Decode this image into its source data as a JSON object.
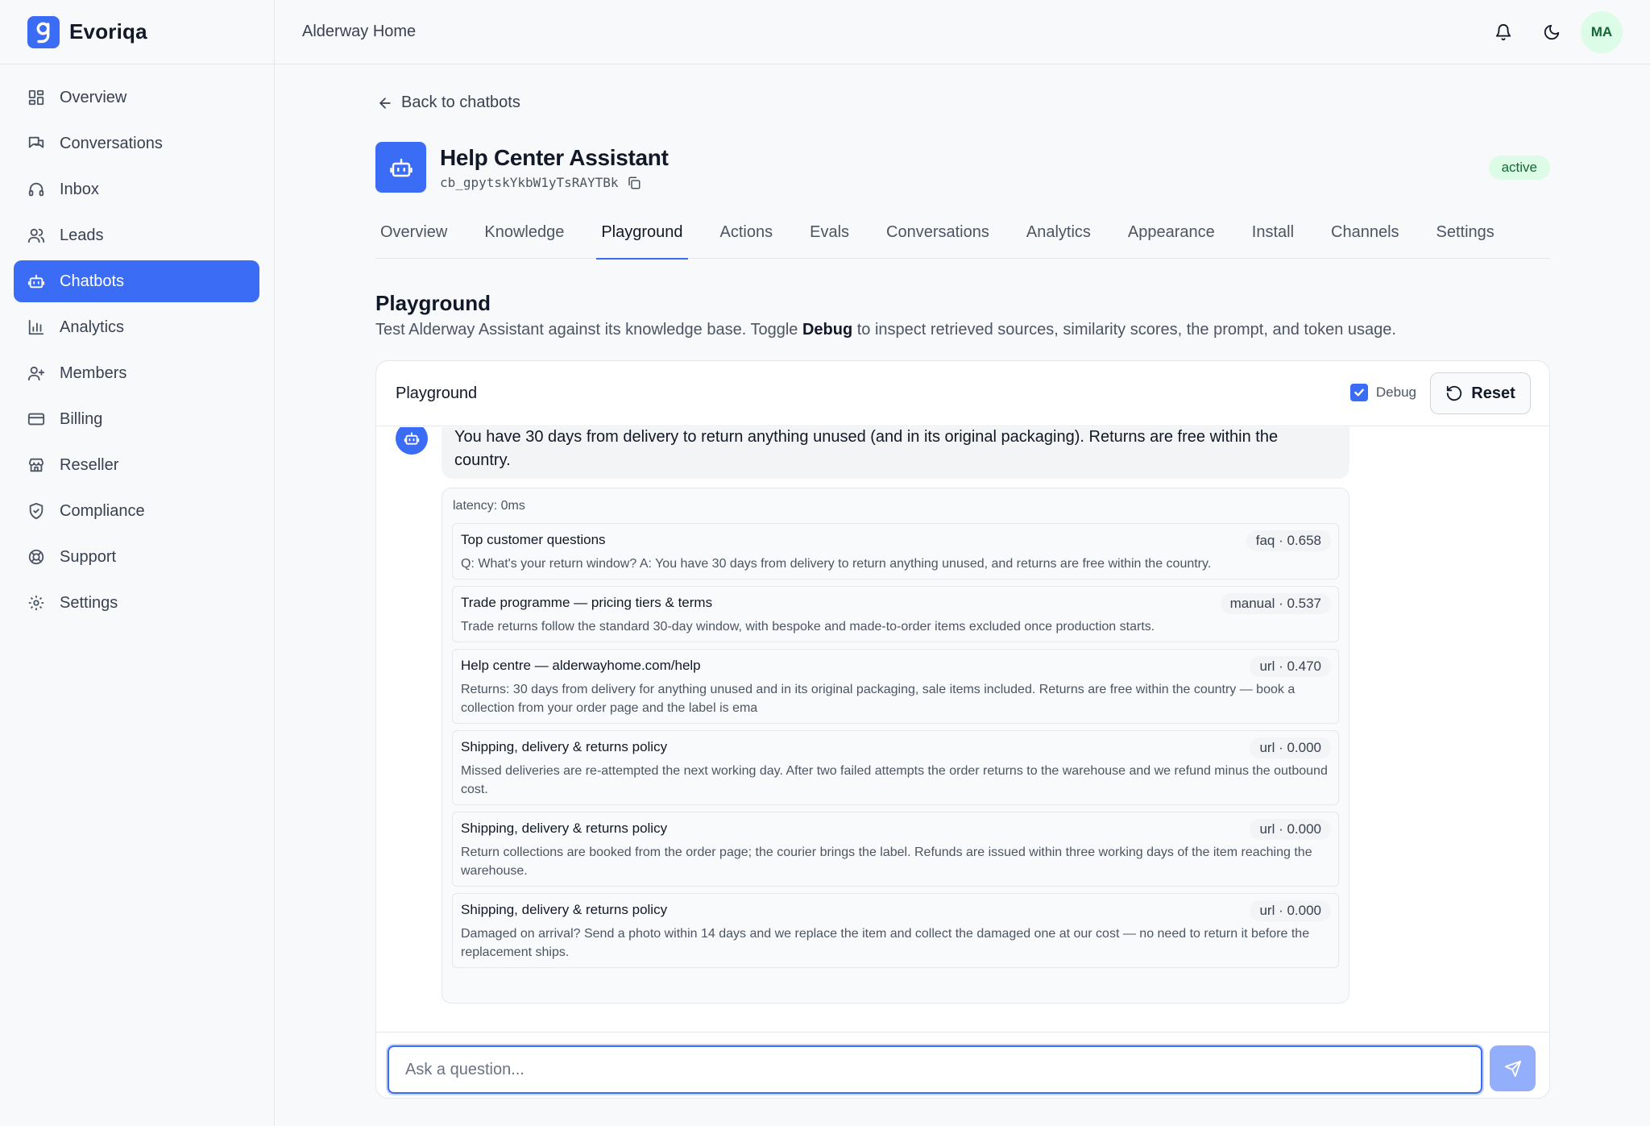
{
  "brand": {
    "name": "Evoriqa"
  },
  "sidebar": {
    "items": [
      {
        "label": "Overview",
        "icon": "grid-icon"
      },
      {
        "label": "Conversations",
        "icon": "chat-bubbles-icon"
      },
      {
        "label": "Inbox",
        "icon": "headset-icon"
      },
      {
        "label": "Leads",
        "icon": "users-icon"
      },
      {
        "label": "Chatbots",
        "icon": "bot-icon",
        "active": true
      },
      {
        "label": "Analytics",
        "icon": "bar-chart-icon"
      },
      {
        "label": "Members",
        "icon": "user-plus-icon"
      },
      {
        "label": "Billing",
        "icon": "credit-card-icon"
      },
      {
        "label": "Reseller",
        "icon": "store-icon"
      },
      {
        "label": "Compliance",
        "icon": "shield-icon"
      },
      {
        "label": "Support",
        "icon": "lifebuoy-icon"
      },
      {
        "label": "Settings",
        "icon": "gear-icon"
      }
    ]
  },
  "topbar": {
    "org_name": "Alderway Home",
    "avatar_initials": "MA"
  },
  "header": {
    "back_label": "Back to chatbots",
    "title": "Help Center Assistant",
    "bot_id": "cb_gpytskYkbW1yTsRAYTBk",
    "status": "active"
  },
  "tabs": [
    {
      "label": "Overview"
    },
    {
      "label": "Knowledge"
    },
    {
      "label": "Playground",
      "active": true
    },
    {
      "label": "Actions"
    },
    {
      "label": "Evals"
    },
    {
      "label": "Conversations"
    },
    {
      "label": "Analytics"
    },
    {
      "label": "Appearance"
    },
    {
      "label": "Install"
    },
    {
      "label": "Channels"
    },
    {
      "label": "Settings"
    }
  ],
  "section": {
    "title": "Playground",
    "desc_before": "Test Alderway Assistant against its knowledge base. Toggle ",
    "desc_bold": "Debug",
    "desc_after": " to inspect retrieved sources, similarity scores, the prompt, and token usage."
  },
  "playground": {
    "title": "Playground",
    "debug_label": "Debug",
    "debug_checked": true,
    "reset_label": "Reset",
    "message": "You have 30 days from delivery to return anything unused (and in its original packaging). Returns are free within the country.",
    "latency": "latency: 0ms",
    "sources": [
      {
        "title": "Top customer questions",
        "meta": "faq · 0.658",
        "text": "Q: What's your return window? A: You have 30 days from delivery to return anything unused, and returns are free within the country."
      },
      {
        "title": "Trade programme — pricing tiers & terms",
        "meta": "manual · 0.537",
        "text": "Trade returns follow the standard 30-day window, with bespoke and made-to-order items excluded once production starts."
      },
      {
        "title": "Help centre — alderwayhome.com/help",
        "meta": "url · 0.470",
        "text": "Returns: 30 days from delivery for anything unused and in its original packaging, sale items included. Returns are free within the country — book a collection from your order page and the label is ema"
      },
      {
        "title": "Shipping, delivery & returns policy",
        "meta": "url · 0.000",
        "text": "Missed deliveries are re-attempted the next working day. After two failed attempts the order returns to the warehouse and we refund minus the outbound cost."
      },
      {
        "title": "Shipping, delivery & returns policy",
        "meta": "url · 0.000",
        "text": "Return collections are booked from the order page; the courier brings the label. Refunds are issued within three working days of the item reaching the warehouse."
      },
      {
        "title": "Shipping, delivery & returns policy",
        "meta": "url · 0.000",
        "text": "Damaged on arrival? Send a photo within 14 days and we replace the item and collect the damaged one at our cost — no need to return it before the replacement ships."
      }
    ],
    "input_placeholder": "Ask a question..."
  },
  "colors": {
    "accent": "#3b6cf6",
    "active_badge_bg": "#dcfce7",
    "active_badge_text": "#166534"
  }
}
